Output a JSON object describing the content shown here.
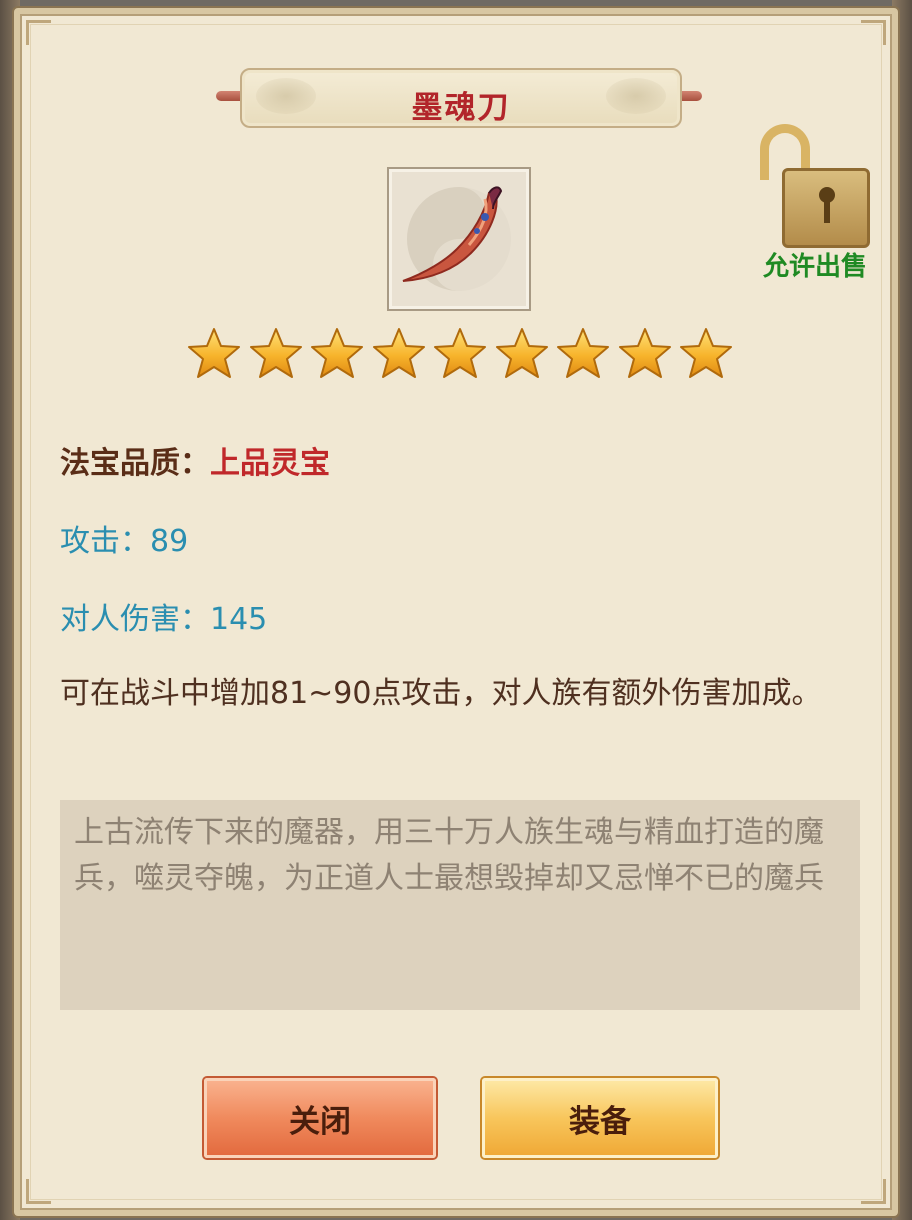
{
  "item": {
    "name": "墨魂刀",
    "star_count": 9,
    "quality_label": "法宝品质：",
    "quality_value": "上品灵宝",
    "attack_text": "攻击：89",
    "damage_text": "对人伤害：145",
    "description": "可在战斗中增加81~90点攻击，对人族有额外伤害加成。",
    "lore": "上古流传下来的魔器，用三十万人族生魂与精血打造的魔兵，噬灵夺魄，为正道人士最想毁掉却又忌惮不已的魔兵"
  },
  "sell": {
    "label": "允许出售",
    "icon": "unlocked-padlock-icon"
  },
  "buttons": {
    "close_label": "关闭",
    "equip_label": "装备"
  },
  "colors": {
    "title": "#b2252a",
    "quality_value": "#c0282a",
    "stat_text": "#2a8eb0",
    "sell_label": "#1f8a23",
    "star_fill": "#f7b42c"
  }
}
